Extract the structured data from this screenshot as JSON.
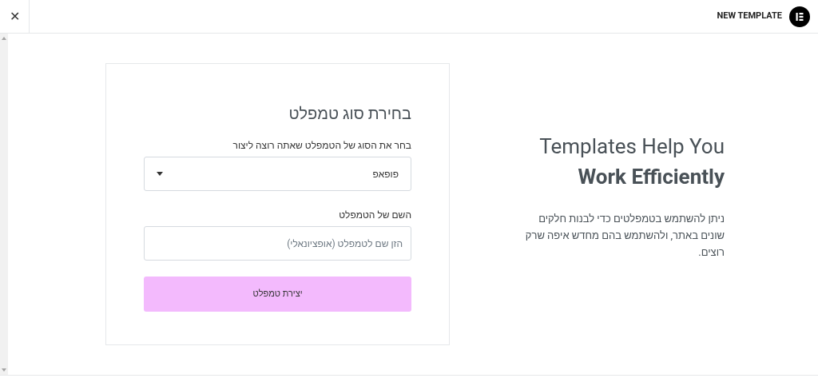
{
  "header": {
    "close_glyph": "✕",
    "title": "NEW TEMPLATE"
  },
  "form": {
    "heading": "בחירת סוג טמפלט",
    "type_label": "בחר את הסוג של הטמפלט שאתה רוצה ליצור",
    "type_value": "פופאפ",
    "name_label": "השם של הטמפלט",
    "name_placeholder": "הזן שם לטמפלט (אופציונאלי)",
    "submit": "יצירת טמפלט"
  },
  "intro": {
    "title_light": "Templates Help You",
    "title_bold": "Work Efficiently",
    "description": "ניתן להשתמש בטמפלטים כדי לבנות חלקים שונים באתר, ולהשתמש בהם מחדש איפה שרק רוצים."
  }
}
